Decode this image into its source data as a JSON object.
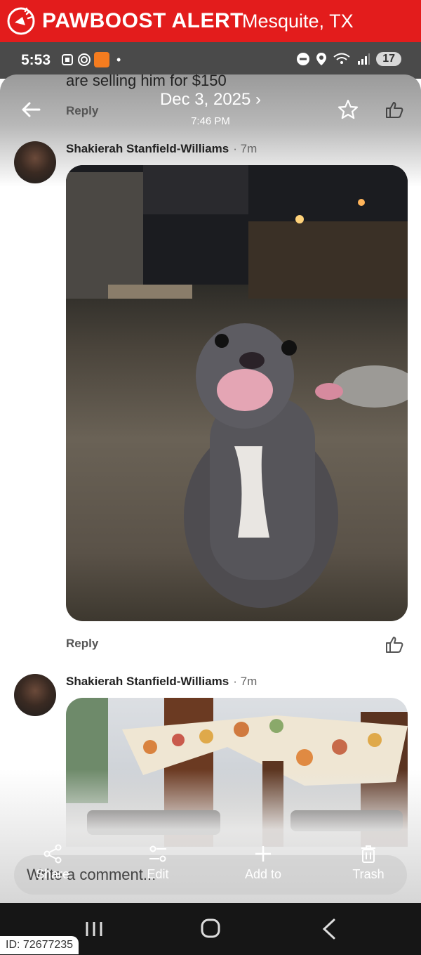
{
  "banner": {
    "brand": "PAWBOOST ALERT",
    "location": "Mesquite, TX",
    "color": "#e31c1c"
  },
  "statusbar": {
    "time": "5:53",
    "notification_badge": "17"
  },
  "header": {
    "date": "Dec 3, 2025",
    "chevron": "›",
    "time": "7:46 PM"
  },
  "previous_comment": {
    "text": "are selling him for $150",
    "reply_label": "Reply"
  },
  "comments": [
    {
      "author": "Shakierah Stanfield-Williams",
      "ago": "· 7m",
      "reply_label": "Reply"
    },
    {
      "author": "Shakierah Stanfield-Williams",
      "ago": "· 7m"
    }
  ],
  "comment_input": {
    "placeholder": "Write a comment..."
  },
  "actions": [
    {
      "label": "Share",
      "icon": "share-icon"
    },
    {
      "label": "Edit",
      "icon": "sliders-icon"
    },
    {
      "label": "Add to",
      "icon": "plus-icon"
    },
    {
      "label": "Trash",
      "icon": "trash-icon"
    }
  ],
  "watermark": {
    "id": "ID: 72677235"
  }
}
